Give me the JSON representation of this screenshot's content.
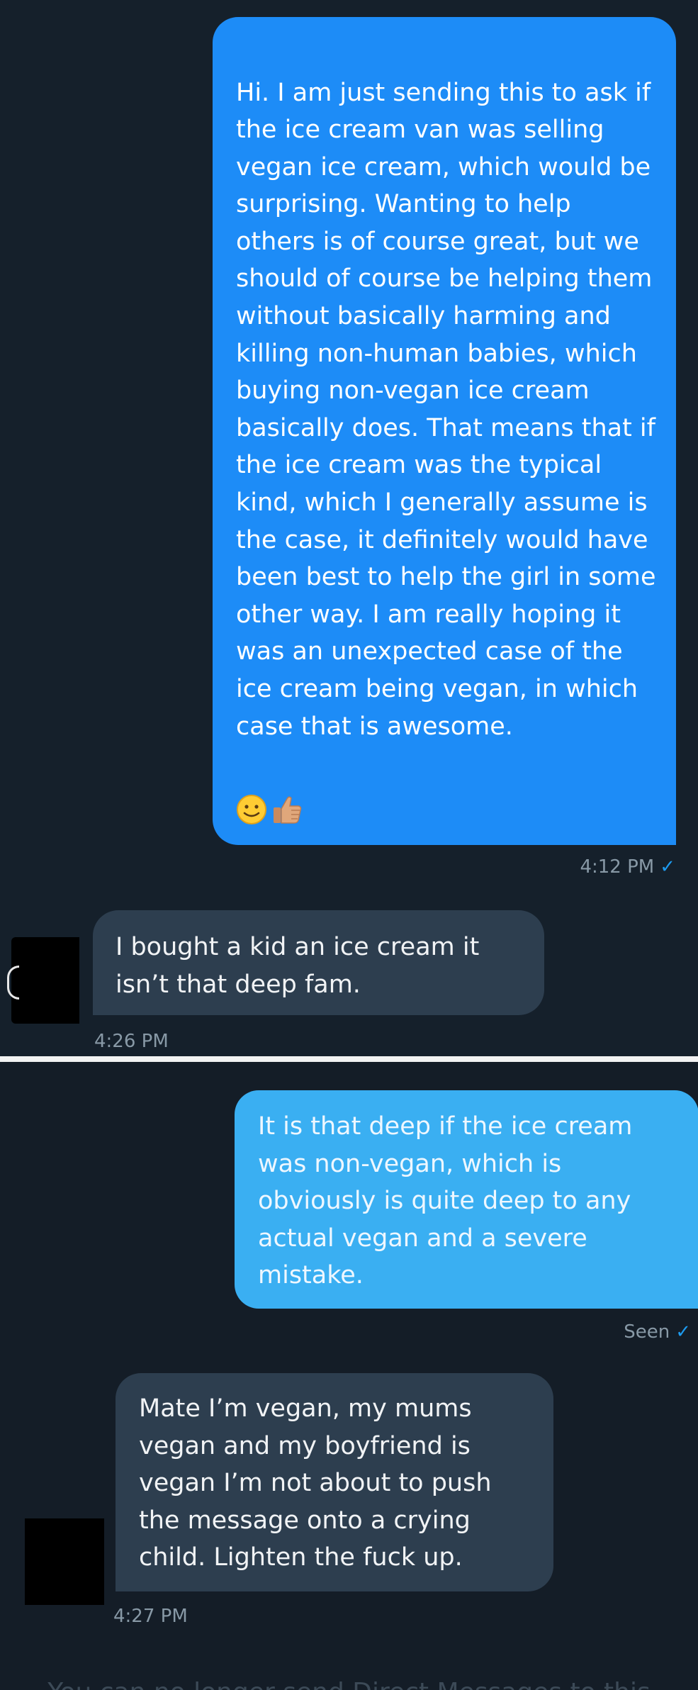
{
  "conversation": {
    "messages": [
      {
        "direction": "sent",
        "text": "Hi. I am just sending this to ask if the ice cream van was selling vegan ice cream, which would be surprising. Wanting to help others is of course great, but we should of course be helping them without basically harming and killing non-human babies, which buying non-vegan ice cream basically does. That means that if the ice cream was the typical kind, which I generally assume is the case, it definitely would have been best to help the girl in some other way. I am really hoping it was an unexpected case of the ice cream being vegan, in which case that is awesome.",
        "emojis": [
          "slightly-smiling-face",
          "thumbs-up"
        ],
        "time": "4:12 PM",
        "check": "✓"
      },
      {
        "direction": "received",
        "text": "I bought a kid an ice cream it isn’t that deep fam.",
        "time": "4:26 PM"
      },
      {
        "direction": "sent",
        "text": "It is that deep if the ice cream was non-vegan, which is obviously is quite deep to any actual vegan and a severe mistake.",
        "status": "Seen",
        "check": "✓"
      },
      {
        "direction": "received",
        "text": "Mate I’m vegan, my mums vegan and my boyfriend is vegan I’m not about to push the message onto a crying child. Lighten the fuck up.",
        "time": "4:27 PM"
      }
    ],
    "footer_partial": "You can no longer send Direct Messages to this"
  },
  "colors": {
    "background": "#15202b",
    "sent_bubble": "#1d8cf7",
    "sent_bubble_light": "#3aaff2",
    "received_bubble": "#2d3e4f",
    "meta_text": "#8899a6",
    "check": "#1d9bf0"
  }
}
